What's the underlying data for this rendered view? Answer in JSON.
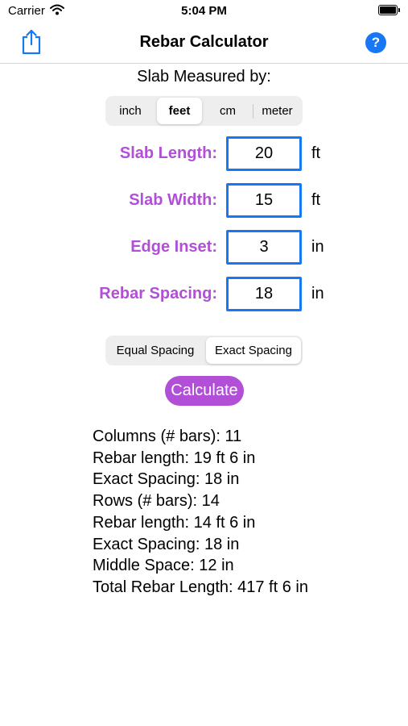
{
  "status_bar": {
    "carrier": "Carrier",
    "time": "5:04 PM"
  },
  "nav": {
    "title": "Rebar Calculator",
    "help_label": "?"
  },
  "measured_by": {
    "label": "Slab Measured by:",
    "options": [
      "inch",
      "feet",
      "cm",
      "meter"
    ],
    "selected": "feet"
  },
  "fields": {
    "length": {
      "label": "Slab Length:",
      "value": "20",
      "unit": "ft"
    },
    "width": {
      "label": "Slab Width:",
      "value": "15",
      "unit": "ft"
    },
    "inset": {
      "label": "Edge Inset:",
      "value": "3",
      "unit": "in"
    },
    "spacing": {
      "label": "Rebar Spacing:",
      "value": "18",
      "unit": "in"
    }
  },
  "spacing_mode": {
    "options": [
      "Equal Spacing",
      "Exact Spacing"
    ],
    "selected": "Exact Spacing"
  },
  "calculate_label": "Calculate",
  "results": [
    "Columns (# bars): 11",
    "Rebar length: 19 ft 6 in",
    "Exact Spacing: 18 in",
    "Rows (# bars): 14",
    "Rebar length: 14 ft 6 in",
    "Exact Spacing: 18 in",
    "Middle Space: 12 in",
    "Total Rebar Length: 417 ft 6 in"
  ],
  "colors": {
    "accent_purple": "#b14fd6",
    "accent_blue": "#1877f2"
  }
}
